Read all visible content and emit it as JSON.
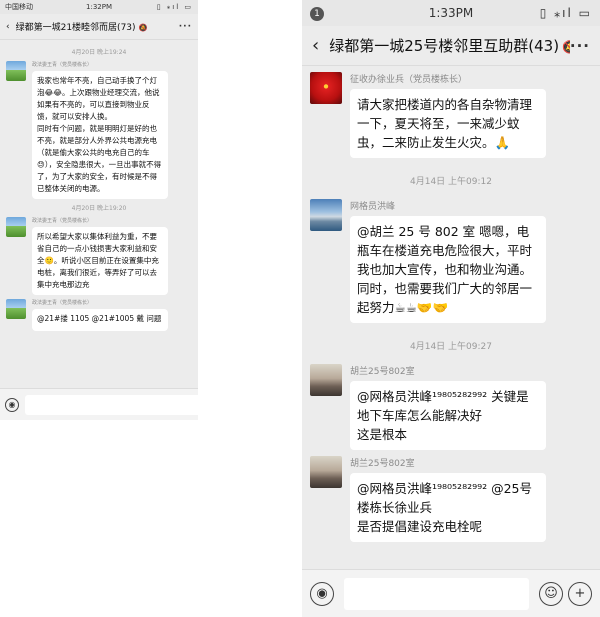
{
  "left": {
    "status": {
      "carrier": "中国移动",
      "time": "1:32PM",
      "icons": "▯ ⁎ıl ▭"
    },
    "header": {
      "back": "‹",
      "title": "绿都第一城21楼睦邻而居(73)",
      "mute": "🔕",
      "more": "···"
    },
    "messages": [
      {
        "type": "time",
        "text": "4月20日 晚上19:24"
      },
      {
        "type": "msg",
        "avatar": "meadow",
        "sender": "政法委王青（党员楼栋长）",
        "paragraphs": [
          "我家也常年不亮，自己动手换了个灯泡😂😂。上次跟物业经理交流，他说如果有不亮的，可以直接到物业反馈，就可以安排人换。",
          "同时有个问题，就是明明灯是好的也不亮，就是部分人外界公共电源充电（就是偷大家公共的电充自己的车😓），安全隐患很大，一旦出事就不得了，为了大家的安全，有时候是不得已整体关闭的电源。"
        ]
      },
      {
        "type": "time",
        "text": "4月20日 晚上19:20"
      },
      {
        "type": "msg",
        "avatar": "meadow",
        "sender": "政法委王青（党员楼栋长）",
        "paragraphs": [
          "所以希望大家以集体利益为重，不要省自己的一点小钱损害大家利益和安全🙂。听说小区目前正在设置集中充电桩，离我们很近，等弄好了可以去集中充电那边充"
        ]
      },
      {
        "type": "msg",
        "avatar": "meadow",
        "sender": "政法委王青（党员楼栋长）",
        "cut": true,
        "paragraphs": [
          "@21#搂 1105 @21#1005 戴  问题"
        ]
      }
    ],
    "input": {
      "voice_icon": "◉",
      "emoji_icon": "☺",
      "plus_icon": "+"
    }
  },
  "right": {
    "status": {
      "dot": "1",
      "time": "1:33PM",
      "icons": "▯ ⁎ıl ▭"
    },
    "header": {
      "back": "‹",
      "title": "绿都第一城25号楼邻里互助群(43)",
      "mute": "🔕",
      "more": "···"
    },
    "messages": [
      {
        "type": "msg",
        "avatar": "flower",
        "sender": "征收办徐业兵（党员楼栋长）",
        "paragraphs": [
          "请大家把楼道内的各自杂物清理一下，夏天将至，一来减少蚊虫，二来防止发生火灾。🙏"
        ]
      },
      {
        "type": "time",
        "text": "4月14日 上午09:12"
      },
      {
        "type": "msg",
        "avatar": "lake",
        "sender": "网格员洪峰",
        "paragraphs": [
          "@胡兰 25 号 802 室  嗯嗯，电瓶车在楼道充电危险很大，平时我也加大宣传，也和物业沟通。同时，也需要我们广大的邻居一起努力☕☕🤝🤝"
        ]
      },
      {
        "type": "time",
        "text": "4月14日 上午09:27"
      },
      {
        "type": "msg",
        "avatar": "ink",
        "sender": "胡兰25号802室",
        "paragraphs": [
          "@网格员洪峰¹⁹⁸⁰⁵²⁸²⁹⁹² 关键是地下车库怎么能解决好",
          "这是根本"
        ]
      },
      {
        "type": "msg",
        "avatar": "ink",
        "sender": "胡兰25号802室",
        "paragraphs": [
          "@网格员洪峰¹⁹⁸⁰⁵²⁸²⁹⁹² @25号楼栋长徐业兵",
          "是否提倡建设充电栓呢"
        ]
      }
    ],
    "input": {
      "voice_icon": "◉",
      "emoji_icon": "☺",
      "plus_icon": "+"
    }
  }
}
